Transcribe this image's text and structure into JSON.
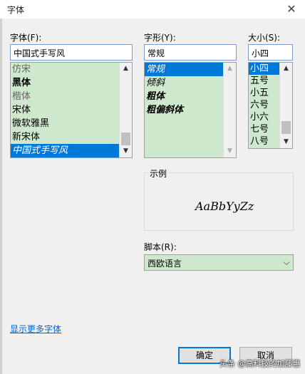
{
  "window": {
    "title": "字体",
    "close_glyph": "✕"
  },
  "font": {
    "label": "字体(F):",
    "value": "中国式手写风",
    "items": [
      "仿宋",
      "黑体",
      "楷体",
      "宋体",
      "微软雅黑",
      "新宋体",
      "中国式手写风"
    ],
    "selected_index": 6
  },
  "style": {
    "label": "字形(Y):",
    "value": "常规",
    "items": [
      "常规",
      "倾斜",
      "粗体",
      "粗偏斜体"
    ],
    "selected_index": 0
  },
  "size": {
    "label": "大小(S):",
    "value": "小四",
    "items": [
      "小四",
      "五号",
      "小五",
      "六号",
      "小六",
      "七号",
      "八号"
    ],
    "selected_index": 0
  },
  "preview": {
    "label": "示例",
    "sample_text": "AaBbYyZz"
  },
  "script": {
    "label": "脚本(R):",
    "value": "西欧语言"
  },
  "more_fonts_link": "显示更多字体",
  "buttons": {
    "ok": "确定",
    "cancel": "取消"
  },
  "watermark": "头条 @高科技的加藤惠",
  "colors": {
    "list_bg": "#cde8cd",
    "selection": "#0078d7",
    "link": "#0066cc"
  }
}
